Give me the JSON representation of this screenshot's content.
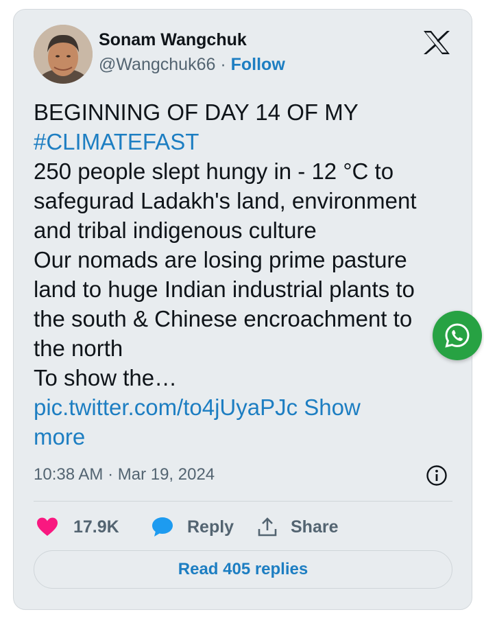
{
  "author": {
    "name": "Sonam Wangchuk",
    "handle": "@Wangchuk66",
    "separator": "·",
    "follow_label": "Follow"
  },
  "tweet": {
    "lines": [
      "BEGINNING OF DAY 14 OF MY",
      "#CLIMATEFAST",
      "250 people slept hungy in - 12 °C to",
      "safegurad Ladakh's land, environment",
      "and tribal indigenous culture",
      "Our nomads are losing prime pasture",
      "land to huge Indian industrial plants to",
      "the south & Chinese encroachment to",
      "the north",
      "To show the…"
    ],
    "pic_link": "pic.twitter.com/to4jUyaPJc",
    "show_more_1": "Show",
    "show_more_2": "more",
    "timestamp": "10:38 AM · Mar 19, 2024"
  },
  "actions": {
    "likes": "17.9K",
    "reply_label": "Reply",
    "share_label": "Share"
  },
  "read_replies_label": "Read 405 replies",
  "icons": {
    "platform": "x-logo-icon",
    "info": "info-icon",
    "like": "heart-icon",
    "reply": "speech-bubble-icon",
    "share": "share-upload-icon",
    "floating": "whatsapp-icon"
  },
  "colors": {
    "link": "#1d7ec2",
    "like": "#f91880",
    "reply": "#1d9bf0",
    "whatsapp": "#27a243",
    "card_bg": "#e8ecef"
  }
}
